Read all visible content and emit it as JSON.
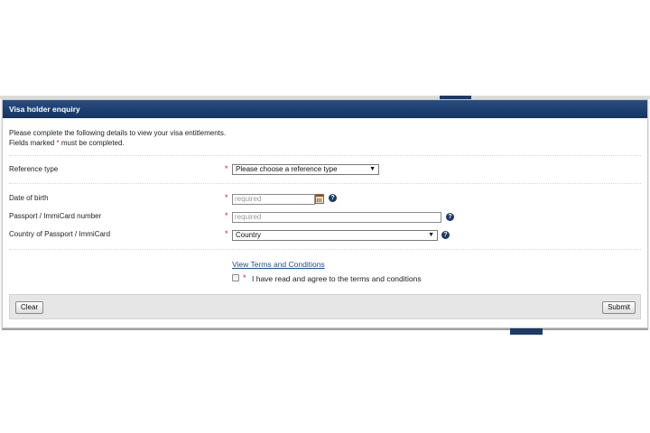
{
  "panel": {
    "title": "Visa holder enquiry",
    "intro_line1": "Please complete the following details to view your visa entitlements.",
    "intro_line2_prefix": "Fields marked",
    "required_marker": "*",
    "intro_line2_suffix": "must be completed."
  },
  "form": {
    "reference_type": {
      "label": "Reference type",
      "selected": "Please choose a reference type"
    },
    "date_of_birth": {
      "label": "Date of birth",
      "placeholder": "required"
    },
    "passport_number": {
      "label": "Passport / ImmiCard number",
      "placeholder": "required"
    },
    "country": {
      "label": "Country of Passport / ImmiCard",
      "selected": "Country"
    },
    "terms_link": "View Terms and Conditions",
    "terms_agree": "I have read and agree to the terms and conditions"
  },
  "icons": {
    "help": "?",
    "dropdown": "▼"
  },
  "footer": {
    "clear_label": "Clear",
    "submit_label": "Submit"
  },
  "colors": {
    "header": "#1d3b66",
    "required": "#cc2233",
    "link": "#1d4f8a"
  }
}
